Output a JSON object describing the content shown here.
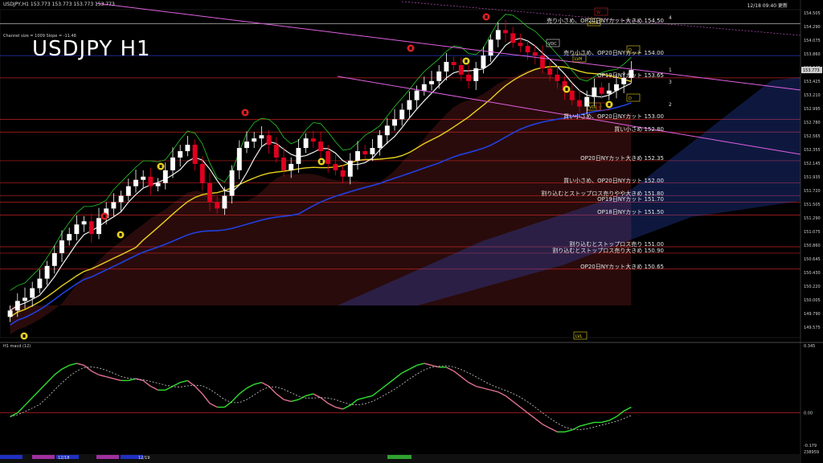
{
  "header": {
    "symbol_line": "USDJPY,H1  153.773 153.773 153.773 153.773",
    "channel_info": "Channel size = 1009 Slope = -11.48",
    "datetime": "12/18 09:40 更新",
    "macd_label": "H1  macd (12)",
    "chart_title": "USDJPY H1"
  },
  "price_axis": {
    "labels": [
      "154.505",
      "154.290",
      "154.075",
      "153.860",
      "153.645",
      "153.425",
      "153.210",
      "152.995",
      "152.780",
      "152.565",
      "152.355",
      "152.145",
      "151.935",
      "151.720",
      "151.505",
      "151.290",
      "151.075",
      "150.860",
      "150.645",
      "150.430",
      "150.220",
      "150.005",
      "149.790",
      "149.575"
    ],
    "current": "153.773"
  },
  "macd_axis": {
    "top": "0.345",
    "zero": "0.00",
    "bottom": "-0.179",
    "lower": "238959"
  },
  "bottom_bar": {
    "dates": [
      "12/18",
      "12/19"
    ]
  },
  "levels": [
    {
      "text": "売り小さめ、OP20日NYカット大きめ 154.50",
      "price": 154.5,
      "color": "#d8d8d8"
    },
    {
      "text": "売り小さめ、OP20日NYカット 154.00",
      "price": 154.0,
      "color": "#2838c8"
    },
    {
      "text": "OP19日NYカット 153.65",
      "price": 153.65,
      "color": "#c02020"
    },
    {
      "text": "買い小さめ、OP20日NYカット 153.00",
      "price": 153.0,
      "color": "#c02020"
    },
    {
      "text": "買い小さめ 152.80",
      "price": 152.8,
      "color": "#c02020"
    },
    {
      "text": "OP20日NYカット大きめ 152.35",
      "price": 152.35,
      "color": "#c02020"
    },
    {
      "text": "買い小さめ、OP20日NYカット 152.00",
      "price": 152.0,
      "color": "#c02020"
    },
    {
      "text": "割り込むとストップロス売りやや大きめ 151.80",
      "price": 151.8,
      "color": "#c02020"
    },
    {
      "text": "OP19日NYカット 151.70",
      "price": 151.7,
      "color": "#c02020"
    },
    {
      "text": "OP18日NYカット 151.50",
      "price": 151.5,
      "color": "#c02020"
    },
    {
      "text": "割り込むとストップロス売り 151.00",
      "price": 151.0,
      "color": "#c02020"
    },
    {
      "text": "割り込むとストップロス売り大きめ 150.90",
      "price": 150.9,
      "color": "#c02020"
    },
    {
      "text": "OP20日NYカット大きめ 150.65",
      "price": 150.65,
      "color": "#c02020"
    }
  ],
  "markers": {
    "vdh": "VDH",
    "vdc": "VDC",
    "vdl": "VDL",
    "lvl": "LVL",
    "lvh": "LVH",
    "d": "D",
    "w": "W",
    "n1": "1",
    "n2": "2",
    "n3": "3",
    "n4": "4"
  },
  "colors": {
    "bull": "#ffffff",
    "bear": "#e00020",
    "white_ma": "#f0f0f0",
    "yellow_ma": "#e8d020",
    "blue_ma": "#2040e0",
    "green": "#28c828",
    "magenta": "#e060e0",
    "cloud_red": "#c03030",
    "cloud_blue": "#3050d0"
  },
  "chart_data": {
    "type": "candlestick",
    "symbol": "USDJPY",
    "timeframe": "H1",
    "ylim": [
      149.575,
      154.72
    ],
    "close": [
      150.0,
      150.15,
      150.2,
      150.35,
      150.5,
      150.7,
      150.9,
      151.1,
      151.2,
      151.35,
      151.4,
      151.2,
      151.45,
      151.6,
      151.7,
      151.8,
      151.95,
      152.05,
      152.1,
      151.95,
      152.0,
      152.2,
      152.4,
      152.5,
      152.6,
      152.3,
      152.0,
      151.7,
      151.6,
      151.8,
      152.2,
      152.55,
      152.65,
      152.7,
      152.75,
      152.6,
      152.4,
      152.2,
      152.3,
      152.55,
      152.7,
      152.65,
      152.5,
      152.3,
      152.2,
      152.1,
      152.35,
      152.5,
      152.45,
      152.55,
      152.75,
      152.9,
      153.0,
      153.15,
      153.3,
      153.45,
      153.55,
      153.6,
      153.75,
      153.9,
      153.85,
      153.7,
      153.6,
      153.8,
      154.0,
      154.25,
      154.4,
      154.35,
      154.2,
      154.15,
      154.05,
      154.0,
      153.8,
      153.7,
      153.6,
      153.45,
      153.3,
      153.2,
      153.35,
      153.5,
      153.4,
      153.45,
      153.55,
      153.65,
      153.773
    ],
    "macd": [
      -0.02,
      0.0,
      0.04,
      0.08,
      0.12,
      0.16,
      0.2,
      0.23,
      0.25,
      0.26,
      0.25,
      0.22,
      0.2,
      0.19,
      0.18,
      0.17,
      0.17,
      0.18,
      0.17,
      0.14,
      0.12,
      0.12,
      0.14,
      0.16,
      0.17,
      0.14,
      0.1,
      0.05,
      0.03,
      0.03,
      0.06,
      0.1,
      0.13,
      0.15,
      0.16,
      0.14,
      0.1,
      0.07,
      0.06,
      0.07,
      0.09,
      0.1,
      0.08,
      0.05,
      0.03,
      0.02,
      0.04,
      0.07,
      0.08,
      0.09,
      0.12,
      0.15,
      0.18,
      0.21,
      0.23,
      0.25,
      0.26,
      0.25,
      0.24,
      0.24,
      0.22,
      0.19,
      0.16,
      0.14,
      0.13,
      0.12,
      0.11,
      0.09,
      0.06,
      0.03,
      0.0,
      -0.03,
      -0.06,
      -0.08,
      -0.1,
      -0.1,
      -0.09,
      -0.07,
      -0.06,
      -0.05,
      -0.05,
      -0.04,
      -0.02,
      0.01,
      0.03
    ]
  }
}
